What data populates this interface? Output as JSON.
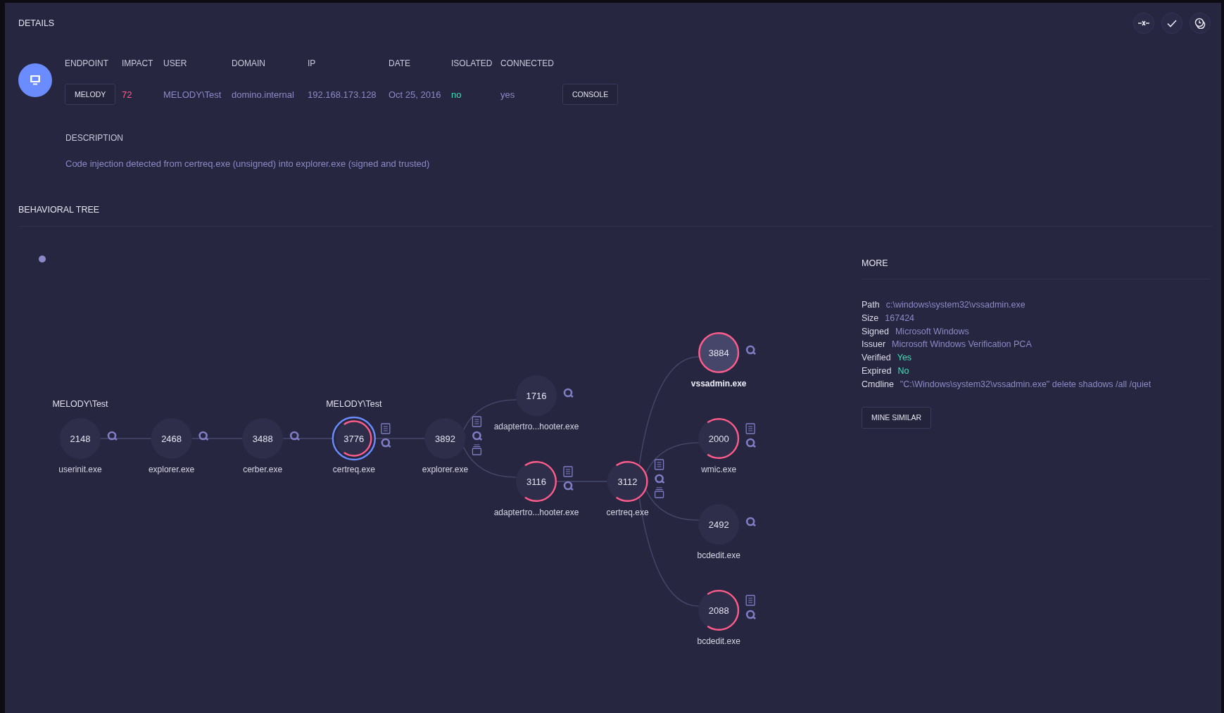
{
  "details": {
    "title": "DETAILS",
    "fields": [
      {
        "label": "ENDPOINT",
        "value": "MELODY",
        "kind": "button"
      },
      {
        "label": "IMPACT",
        "value": "72",
        "kind": "text",
        "color": "#ff5c8a"
      },
      {
        "label": "USER",
        "value": "MELODY\\Test",
        "kind": "text",
        "color": "#8c8ac6"
      },
      {
        "label": "DOMAIN",
        "value": "domino.internal",
        "kind": "text",
        "color": "#8c8ac6"
      },
      {
        "label": "IP",
        "value": "192.168.173.128",
        "kind": "text",
        "color": "#8c8ac6"
      },
      {
        "label": "DATE",
        "value": "Oct 25, 2016",
        "kind": "text",
        "color": "#8c8ac6"
      },
      {
        "label": "ISOLATED",
        "value": "no",
        "kind": "text",
        "color": "#3ee0b5"
      },
      {
        "label": "CONNECTED",
        "value": "yes",
        "kind": "text",
        "color": "#8c8ac6"
      }
    ],
    "console_button": "CONSOLE",
    "description_label": "DESCRIPTION",
    "description": "Code injection detected from certreq.exe (unsigned) into explorer.exe (signed and trusted)"
  },
  "behavioral_tree": {
    "title": "BEHAVIORAL TREE",
    "root": {
      "pid": "2148",
      "name": "userinit.exe",
      "user": "MELODY\\Test",
      "flagged": false,
      "selected": false,
      "highlighted": false,
      "icons": [
        {
          "kind": "search"
        }
      ],
      "children": [
        {
          "pid": "2468",
          "name": "explorer.exe",
          "flagged": false,
          "selected": false,
          "highlighted": false,
          "icons": [
            {
              "kind": "search"
            }
          ],
          "children": [
            {
              "pid": "3488",
              "name": "cerber.exe",
              "flagged": false,
              "selected": false,
              "highlighted": false,
              "icons": [
                {
                  "kind": "search"
                }
              ],
              "children": [
                {
                  "pid": "3776",
                  "name": "certreq.exe",
                  "user": "MELODY\\Test",
                  "flagged": true,
                  "selected": false,
                  "highlighted": true,
                  "icons": [
                    {
                      "kind": "doc"
                    },
                    {
                      "kind": "search"
                    }
                  ],
                  "children": [
                    {
                      "pid": "3892",
                      "name": "explorer.exe",
                      "flagged": false,
                      "selected": false,
                      "highlighted": false,
                      "icons": [
                        {
                          "kind": "doc"
                        },
                        {
                          "kind": "search"
                        },
                        {
                          "kind": "stack"
                        }
                      ],
                      "children": [
                        {
                          "pid": "1716",
                          "name": "adaptertro...hooter.exe",
                          "flagged": false,
                          "selected": false,
                          "highlighted": false,
                          "icons": [
                            {
                              "kind": "search"
                            }
                          ]
                        },
                        {
                          "pid": "3116",
                          "name": "adaptertro...hooter.exe",
                          "flagged": true,
                          "selected": false,
                          "highlighted": false,
                          "icons": [
                            {
                              "kind": "doc"
                            },
                            {
                              "kind": "search"
                            }
                          ],
                          "children": [
                            {
                              "pid": "3112",
                              "name": "certreq.exe",
                              "flagged": true,
                              "selected": false,
                              "highlighted": false,
                              "icons": [
                                {
                                  "kind": "doc"
                                },
                                {
                                  "kind": "search"
                                },
                                {
                                  "kind": "stack"
                                }
                              ],
                              "children": [
                                {
                                  "pid": "3884",
                                  "name": "vssadmin.exe",
                                  "flagged": true,
                                  "selected": true,
                                  "highlighted": false,
                                  "icons": [
                                    {
                                      "kind": "search"
                                    }
                                  ]
                                },
                                {
                                  "pid": "2000",
                                  "name": "wmic.exe",
                                  "flagged": true,
                                  "selected": false,
                                  "highlighted": false,
                                  "icons": [
                                    {
                                      "kind": "doc"
                                    },
                                    {
                                      "kind": "search"
                                    }
                                  ]
                                },
                                {
                                  "pid": "2492",
                                  "name": "bcdedit.exe",
                                  "flagged": false,
                                  "selected": false,
                                  "highlighted": false,
                                  "icons": [
                                    {
                                      "kind": "search"
                                    }
                                  ]
                                },
                                {
                                  "pid": "2088",
                                  "name": "bcdedit.exe",
                                  "flagged": true,
                                  "selected": false,
                                  "highlighted": false,
                                  "icons": [
                                    {
                                      "kind": "doc"
                                    },
                                    {
                                      "kind": "search"
                                    }
                                  ]
                                }
                              ]
                            }
                          ]
                        }
                      ]
                    }
                  ]
                }
              ]
            }
          ]
        }
      ]
    }
  },
  "more": {
    "title": "MORE",
    "rows": [
      {
        "label": "Path",
        "value": "c:\\windows\\system32\\vssadmin.exe",
        "color": "#8c8ac6"
      },
      {
        "label": "Size",
        "value": "167424",
        "color": "#8c8ac6"
      },
      {
        "label": "Signed",
        "value": "Microsoft Windows",
        "color": "#8c8ac6"
      },
      {
        "label": "Issuer",
        "value": "Microsoft Windows Verification PCA",
        "color": "#8c8ac6"
      },
      {
        "label": "Verified",
        "value": "Yes",
        "color": "#3ee0b5"
      },
      {
        "label": "Expired",
        "value": "No",
        "color": "#3ee0b5"
      },
      {
        "label": "Cmdline",
        "value": "\"C:\\Windows\\system32\\vssadmin.exe\" delete shadows /all /quiet",
        "color": "#8c8ac6"
      }
    ],
    "button": "MINE SIMILAR"
  }
}
